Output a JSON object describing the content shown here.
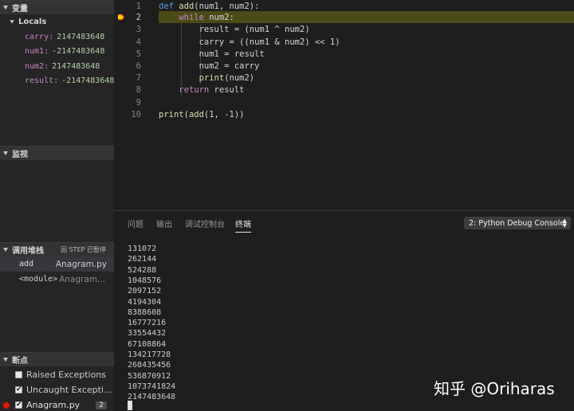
{
  "variables": {
    "header": "变量",
    "locals_label": "Locals",
    "items": [
      {
        "name": "carry:",
        "value": "2147483648"
      },
      {
        "name": "num1:",
        "value": "-2147483648"
      },
      {
        "name": "num2:",
        "value": "2147483648"
      },
      {
        "name": "result:",
        "value": "-2147483648"
      }
    ]
  },
  "watch": {
    "header": "监视"
  },
  "call_stack": {
    "header": "调用堆栈",
    "status": "因 STEP 已暂停",
    "frames": [
      {
        "name": "add",
        "file": "Anagram.py"
      },
      {
        "name": "<module>",
        "file": "Anagram..."
      }
    ]
  },
  "breakpoints": {
    "header": "断点",
    "items": [
      {
        "label": "Raised Exceptions",
        "checked": false
      },
      {
        "label": "Uncaught Excepti...",
        "checked": true
      },
      {
        "label": "Anagram.py",
        "checked": true,
        "count": "2"
      }
    ]
  },
  "editor": {
    "lines": [
      {
        "num": "1",
        "code": "def add(num1, num2):"
      },
      {
        "num": "2",
        "code": "    while num2:"
      },
      {
        "num": "3",
        "code": "        result = (num1 ^ num2)"
      },
      {
        "num": "4",
        "code": "        carry = ((num1 & num2) << 1)"
      },
      {
        "num": "5",
        "code": "        num1 = result"
      },
      {
        "num": "6",
        "code": "        num2 = carry"
      },
      {
        "num": "7",
        "code": "        print(num2)"
      },
      {
        "num": "8",
        "code": "    return result"
      },
      {
        "num": "9",
        "code": ""
      },
      {
        "num": "10",
        "code": "print(add(1, -1))"
      }
    ],
    "current_line": "2"
  },
  "panel": {
    "tabs": [
      "问题",
      "输出",
      "调试控制台",
      "终端"
    ],
    "active_tab": "终端",
    "console_select": "2: Python Debug Console",
    "output": [
      "131072",
      "262144",
      "524288",
      "1048576",
      "2097152",
      "4194304",
      "8388608",
      "16777216",
      "33554432",
      "67108864",
      "134217728",
      "268435456",
      "536870912",
      "1073741824",
      "2147483648"
    ]
  },
  "watermark": "知乎 @Oriharas",
  "colors": {
    "breakpoint": "#e51400",
    "current_line_bg": "#4b4b18",
    "keyword": "#569cd6",
    "function": "#dcdcaa"
  }
}
